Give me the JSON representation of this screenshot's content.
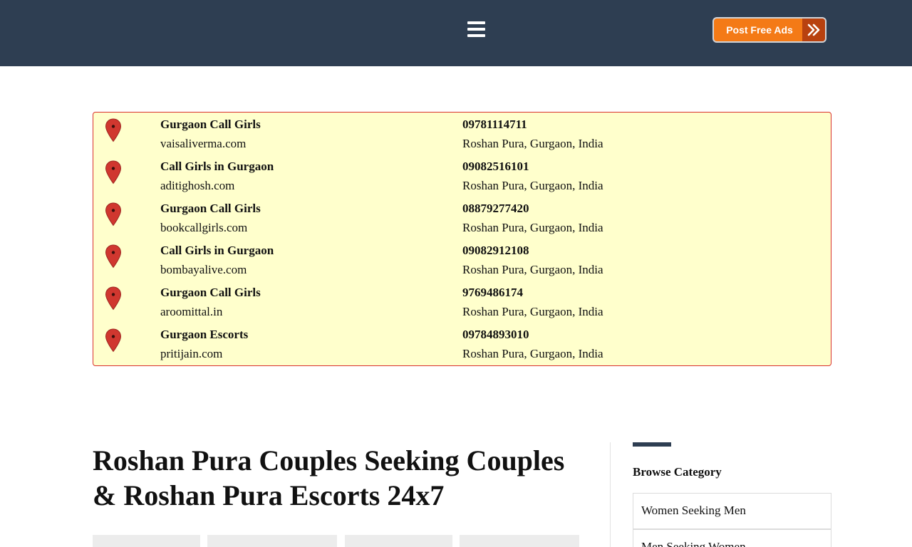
{
  "header": {
    "menu_icon": "hamburger-icon",
    "post_button_label": "Post Free Ads",
    "post_button_icon": "double-chevron-right-icon",
    "bg_color": "#2e3e52",
    "accent_color": "#f47a16"
  },
  "listings": [
    {
      "name": "Gurgaon Call Girls",
      "site": "vaisaliverma.com",
      "phone": "09781114711",
      "address": "Roshan Pura, Gurgaon, India"
    },
    {
      "name": "Call Girls in Gurgaon",
      "site": "aditighosh.com",
      "phone": "09082516101",
      "address": "Roshan Pura, Gurgaon, India"
    },
    {
      "name": "Gurgaon Call Girls",
      "site": "bookcallgirls.com",
      "phone": "08879277420",
      "address": "Roshan Pura, Gurgaon, India"
    },
    {
      "name": "Call Girls in Gurgaon",
      "site": "bombayalive.com",
      "phone": "09082912108",
      "address": "Roshan Pura, Gurgaon, India"
    },
    {
      "name": "Gurgaon Call Girls",
      "site": "aroomittal.in",
      "phone": "9769486174",
      "address": "Roshan Pura, Gurgaon, India"
    },
    {
      "name": "Gurgaon Escorts",
      "site": "pritijain.com",
      "phone": "09784893010",
      "address": "Roshan Pura, Gurgaon, India"
    }
  ],
  "listing_icon": "map-pin-icon",
  "main": {
    "title": "Roshan Pura Couples Seeking Couples & Roshan Pura Escorts 24x7"
  },
  "sidebar": {
    "title": "Browse Category",
    "categories": [
      "Women Seeking Men",
      "Men Seeking Women"
    ]
  }
}
